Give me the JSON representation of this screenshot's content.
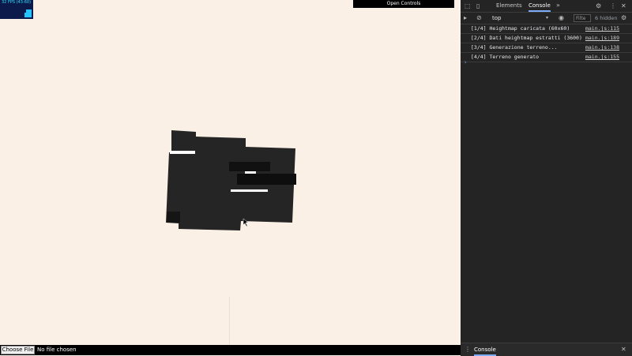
{
  "fps": {
    "text": "32 FPS (43-60)"
  },
  "controls": {
    "open_label": "Open Controls"
  },
  "file_input": {
    "button_label": "Choose File",
    "status": "No file chosen"
  },
  "devtools": {
    "tabs": [
      "Elements",
      "Console"
    ],
    "active_tab": "Console",
    "more_tabs_glyph": "»",
    "context": "top",
    "filter_placeholder": "Filte",
    "hidden_count": "6 hidden",
    "logs": [
      {
        "msg": "[1/4] Heightmap caricata (60x60)",
        "src": "main.js:115"
      },
      {
        "msg": "[2/4] Dati heightmap estratti (3600)",
        "src": "main.js:189"
      },
      {
        "msg": "[3/4] Generazione terreno...",
        "src": "main.js:138"
      },
      {
        "msg": "[4/4] Terreno generato",
        "src": "main.js:155"
      }
    ],
    "prompt_glyph": "›",
    "drawer_tab": "Console"
  },
  "colors": {
    "background": "#faf0e6",
    "terrain": "#222222",
    "devtools_bg": "#242424",
    "accent": "#7cacf8"
  }
}
